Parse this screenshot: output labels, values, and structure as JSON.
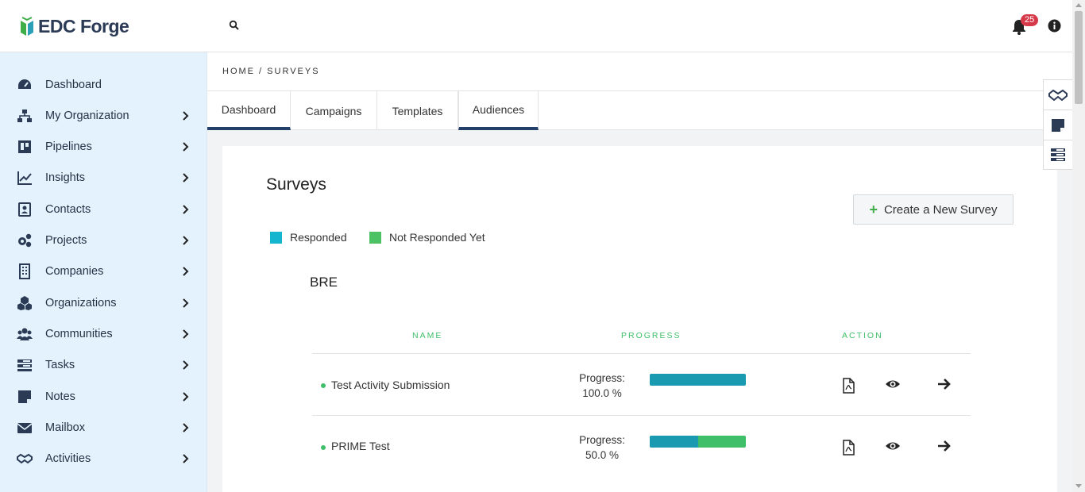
{
  "app": {
    "logo_text": "EDC Forge"
  },
  "header": {
    "notification_count": "25"
  },
  "sidebar": {
    "items": [
      {
        "label": "Dashboard",
        "icon": "gauge-icon",
        "has_chevron": false
      },
      {
        "label": "My Organization",
        "icon": "sitemap-icon",
        "has_chevron": true
      },
      {
        "label": "Pipelines",
        "icon": "kanban-icon",
        "has_chevron": true
      },
      {
        "label": "Insights",
        "icon": "line-chart-icon",
        "has_chevron": true
      },
      {
        "label": "Contacts",
        "icon": "contact-card-icon",
        "has_chevron": true
      },
      {
        "label": "Projects",
        "icon": "cogs-icon",
        "has_chevron": true
      },
      {
        "label": "Companies",
        "icon": "building-icon",
        "has_chevron": true
      },
      {
        "label": "Organizations",
        "icon": "cubes-icon",
        "has_chevron": true
      },
      {
        "label": "Communities",
        "icon": "users-icon",
        "has_chevron": true
      },
      {
        "label": "Tasks",
        "icon": "tasks-icon",
        "has_chevron": true
      },
      {
        "label": "Notes",
        "icon": "note-icon",
        "has_chevron": true
      },
      {
        "label": "Mailbox",
        "icon": "envelope-icon",
        "has_chevron": true
      },
      {
        "label": "Activities",
        "icon": "handshake-icon",
        "has_chevron": true
      }
    ]
  },
  "breadcrumb": "HOME / SURVEYS",
  "tabs": [
    {
      "label": "Dashboard",
      "active": true
    },
    {
      "label": "Campaigns",
      "active": false
    },
    {
      "label": "Templates",
      "active": false
    },
    {
      "label": "Audiences",
      "active": false
    }
  ],
  "page": {
    "title": "Surveys",
    "create_button": "Create a New Survey",
    "legend": [
      {
        "label": "Responded",
        "color": "#15b4cf"
      },
      {
        "label": "Not Responded Yet",
        "color": "#4cc264"
      }
    ],
    "group_title": "BRE",
    "table": {
      "headers": [
        "NAME",
        "PROGRESS",
        "ACTION"
      ],
      "rows": [
        {
          "name": "Test Activity Submission",
          "progress_label": "Progress:",
          "progress_value": "100.0 %",
          "responded_fraction": 1.0
        },
        {
          "name": "PRIME Test",
          "progress_label": "Progress:",
          "progress_value": "50.0 %",
          "responded_fraction": 0.5
        }
      ]
    }
  },
  "colors": {
    "sidebar_bg": "#e3f2fc",
    "accent_green": "#3fbf6a",
    "responded_bar": "#1a9ab0",
    "tab_active_border": "#23406b",
    "badge": "#d63a4a"
  }
}
